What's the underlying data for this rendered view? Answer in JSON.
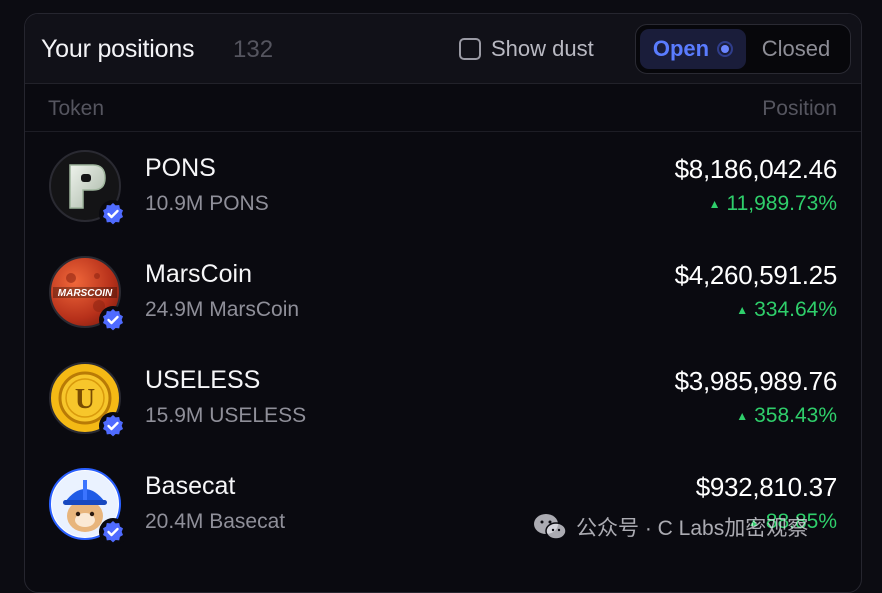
{
  "header": {
    "title": "Your positions",
    "count": "132",
    "show_dust_label": "Show dust",
    "tab_open": "Open",
    "tab_closed": "Closed"
  },
  "columns": {
    "token": "Token",
    "position": "Position"
  },
  "positions": [
    {
      "name": "PONS",
      "amount": "10.9M PONS",
      "value": "$8,186,042.46",
      "change": "11,989.73%",
      "icon": "pons-logo-icon"
    },
    {
      "name": "MarsCoin",
      "amount": "24.9M MarsCoin",
      "value": "$4,260,591.25",
      "change": "334.64%",
      "icon": "marscoin-logo-icon",
      "logo_text": "MARSCOIN"
    },
    {
      "name": "USELESS",
      "amount": "15.9M USELESS",
      "value": "$3,985,989.76",
      "change": "358.43%",
      "icon": "useless-logo-icon",
      "logo_text": "U"
    },
    {
      "name": "Basecat",
      "amount": "20.4M Basecat",
      "value": "$932,810.37",
      "change": "88.85%",
      "icon": "basecat-logo-icon"
    }
  ],
  "watermark": {
    "text": "公众号 · C Labs加密观察"
  },
  "colors": {
    "accent": "#5a7cff",
    "positive": "#2fcf6b",
    "verified": "#4f6bff",
    "background": "#0a0a10"
  }
}
